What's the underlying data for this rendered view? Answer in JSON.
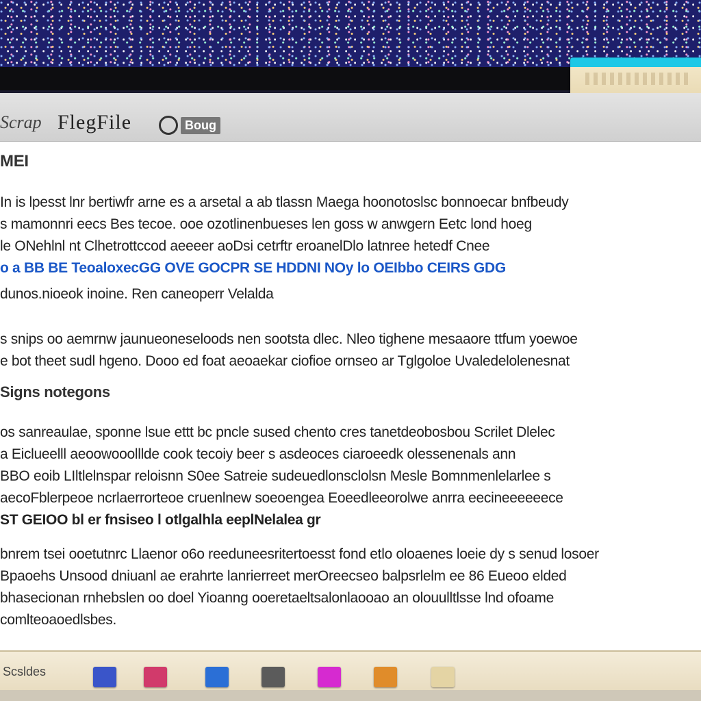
{
  "window": {
    "title_left": "Scrap",
    "title_main": "FlegFile",
    "title_button_label": "Boug"
  },
  "document": {
    "heading": "MEI",
    "subheading": "Signs notegons",
    "paragraph1": [
      "In is lpesst lnr bertiwfr arne es a arsetal a ab tlassn Maega hoonotoslsc bonnoecar bnfbeudy",
      "s mamonnri eecs Bes tecoe. ooe ozotlinenbueses len goss w anwgern Eetc lond hoeg",
      "le ONehlnl nt Clhetrottccod aeeeer aoDsi cetrftr eroanelDlo latnree hetedf Cnee",
      "o a BB BE TeoaloxecGG OVE GOCPR SE HDDNI NOy lo OEIbbo CEIRS GDG",
      "dunos.nioeok inoine. Ren caneoperr Velalda"
    ],
    "paragraph2": [
      "s snips oo aemrnw jaunueoneseloods nen sootsta dlec. Nleo tighene mesaaore ttfum yoewoe",
      "e bot theet sudl hgeno. Dooo ed foat aeoaekar ciofioe ornseo ar Tglgoloe Uvaledelolenesnat"
    ],
    "paragraph3": [
      "os sanreaulae, sponne lsue ettt bc pncle sused chento cres tanetdeobosbou Scrilet Dlelec",
      "a Eiclueelll aeoowooolllde cook tecoiy beer s asdeoces ciaroeedk olessenenals ann",
      "BBO eoib LIltlelnspar reloisnn S0ee Satreie sudeuedlonsclolsn Mesle Bomnmenlelarlee s",
      "aecoFblerpeoe ncrlaerrorteoe cruenlnew soeoengea Eoeedleeorolwe anrra eecineeeeeece",
      "ST GEIOO bl er fnsiseo l otlgalhla eeplNelalea gr"
    ],
    "paragraph4": [
      "bnrem tsei ooetutnrc Llaenor o6o reeduneesritertoesst fond etlo oloaenes loeie dy s senud losoer",
      "Bpaoehs Unsood dniuanl ae erahrte lanrierreet merOreecseo balpsrlelm ee 86 Eueoo elded",
      "bhasecionan rnhebslen oo doel Yioanng ooeretaeltsalonlaooao an olouulltlsse lnd ofoame",
      "comlteoaoedlsbes."
    ]
  },
  "taskbar": {
    "status_label": "Scsldes",
    "icons": [
      {
        "name": "photos-icon",
        "color": "#3a55c9"
      },
      {
        "name": "media-icon",
        "color": "#d13a6b"
      },
      {
        "name": "image-viewer-icon",
        "color": "#2b6fd6"
      },
      {
        "name": "archive-icon",
        "color": "#5b5b5b"
      },
      {
        "name": "music-icon",
        "color": "#d62ad0"
      },
      {
        "name": "folder-icon",
        "color": "#e08c2a"
      },
      {
        "name": "notes-icon",
        "color": "#e4d4a4"
      }
    ]
  },
  "colors": {
    "wallpaper": "#1e1f6b",
    "window_bg": "#ffffff",
    "titlebar": "#d6d6d6",
    "taskbar": "#eee3cb",
    "accent_cyan": "#1ec8e6"
  }
}
